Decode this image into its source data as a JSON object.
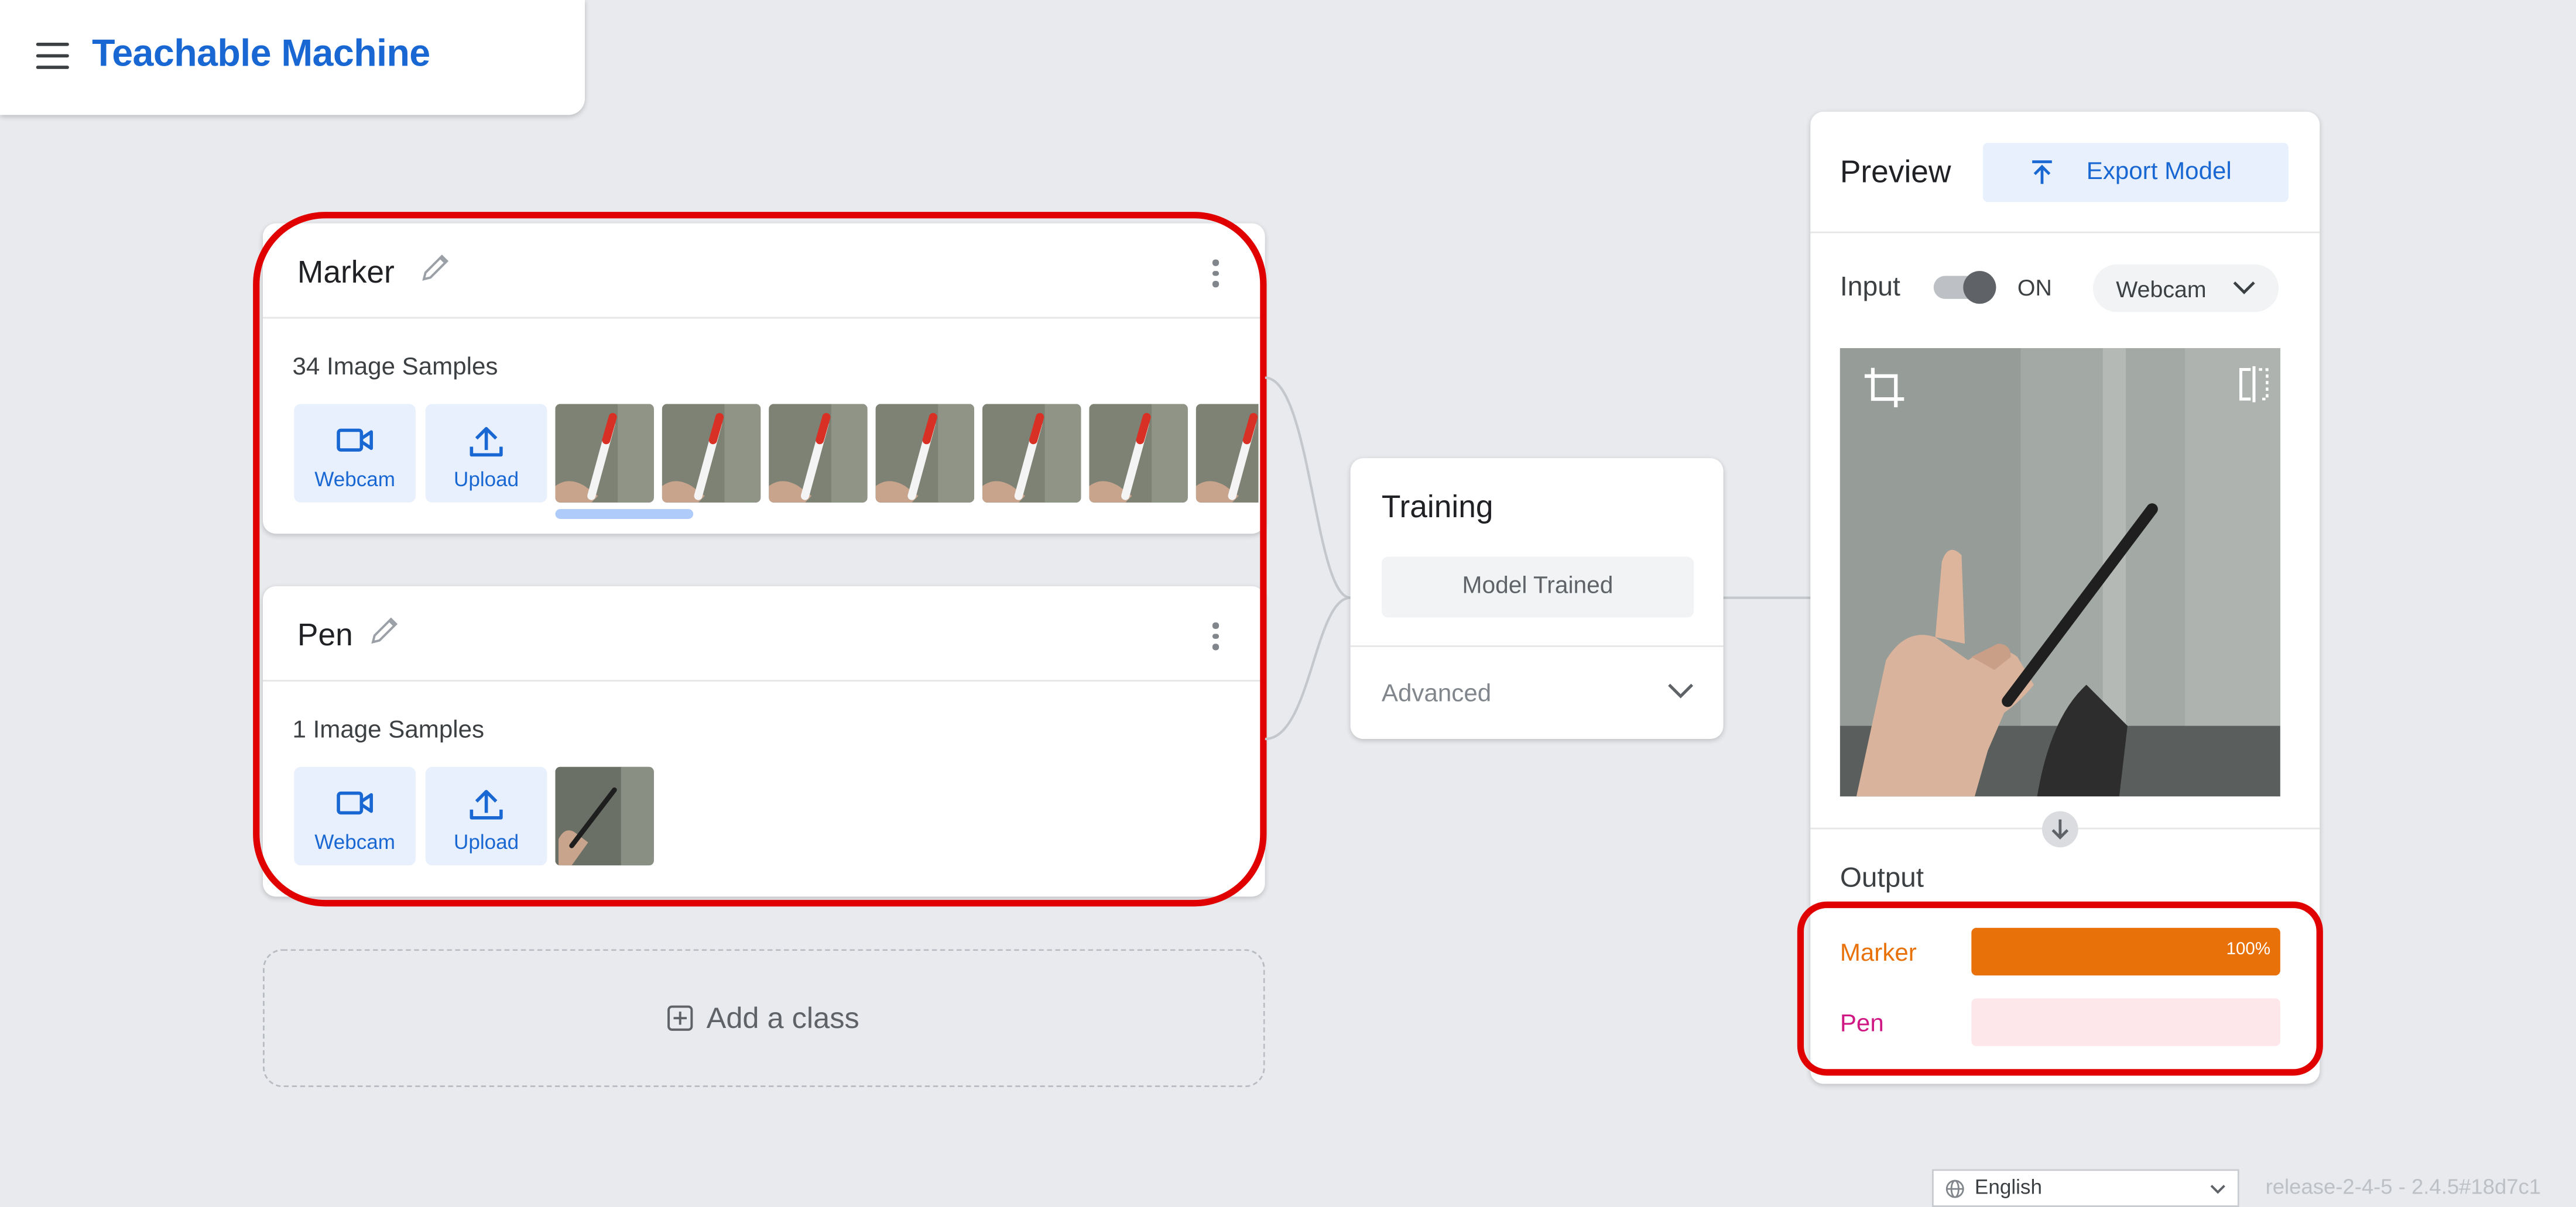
{
  "header": {
    "brand": "Teachable Machine"
  },
  "classes": [
    {
      "name": "Marker",
      "samples_label": "34 Image Samples",
      "webcam_label": "Webcam",
      "upload_label": "Upload"
    },
    {
      "name": "Pen",
      "samples_label": "1 Image Samples",
      "webcam_label": "Webcam",
      "upload_label": "Upload"
    }
  ],
  "add_class_label": "Add a class",
  "training": {
    "title": "Training",
    "status_button": "Model Trained",
    "advanced_label": "Advanced"
  },
  "preview": {
    "title": "Preview",
    "export_label": "Export Model",
    "input_label": "Input",
    "toggle_state": "ON",
    "input_source": "Webcam",
    "output_label": "Output",
    "outputs": [
      {
        "label": "Marker",
        "value": 1.0,
        "pct": "100%",
        "color": "#e8710a",
        "track": "#fce8e6"
      },
      {
        "label": "Pen",
        "value": 0.0,
        "pct": "",
        "color": "#d01884",
        "track": "#fde7ea"
      }
    ]
  },
  "footer": {
    "language": "English",
    "release": "release-2-4-5 - 2.4.5#18d7c1"
  },
  "colors": {
    "accent": "#1967d2",
    "highlight": "#e00000"
  }
}
